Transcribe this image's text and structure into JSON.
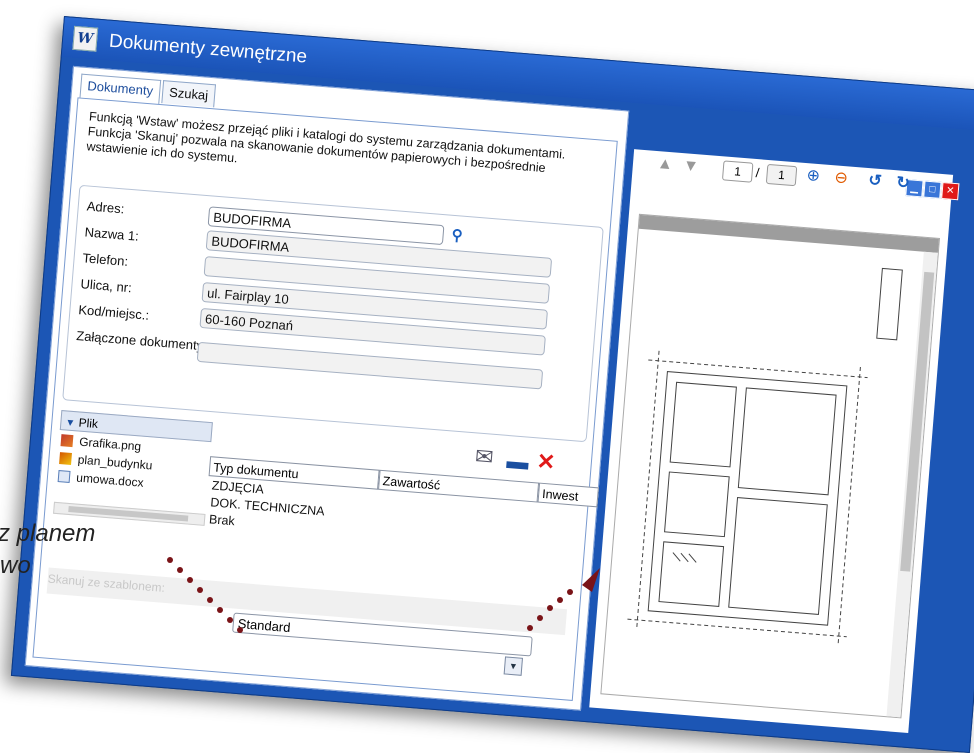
{
  "window": {
    "title": "Dokumenty zewnętrzne",
    "logo": "W"
  },
  "tabs": [
    {
      "label": "Dokumenty"
    },
    {
      "label": "Szukaj"
    }
  ],
  "info_text": "Funkcją 'Wstaw' możesz przejąć pliki i katalogi do systemu zarządzania dokumentami. Funkcja 'Skanuj' pozwala na skanowanie dokumentów papierowych i bezpośrednie wstawienie ich do systemu.",
  "form": {
    "adres_label": "Adres:",
    "adres_value": "BUDOFIRMA",
    "nazwa_label": "Nazwa 1:",
    "nazwa_value": "BUDOFIRMA",
    "telefon_label": "Telefon:",
    "telefon_value": "",
    "ulica_label": "Ulica, nr:",
    "ulica_value": "ul. Fairplay 10",
    "kod_label": "Kod/miejsc.:",
    "kod_value": "60-160 Poznań",
    "zalaczone_label": "Załączone dokumenty:"
  },
  "files": {
    "header": "Plik",
    "items": [
      {
        "name": "Grafika.png",
        "icon": "image-icon"
      },
      {
        "name": "plan_budynku",
        "icon": "image-icon"
      },
      {
        "name": "umowa.docx",
        "icon": "doc-icon"
      }
    ]
  },
  "grid": {
    "columns": [
      "Typ dokumentu",
      "Zawartość",
      "Inwest"
    ],
    "types": [
      "ZDJĘCIA",
      "DOK. TECHNICZNA",
      "Brak"
    ]
  },
  "bottom": {
    "faded_label": "Skanuj ze szablonem:",
    "select_value": "Standard"
  },
  "viewer": {
    "page_current": "1",
    "page_sep": "/",
    "page_total": "1"
  },
  "overlay": {
    "line1": "z planem",
    "line2": "wo"
  },
  "colors": {
    "window_blue": "#1c56b5",
    "accent": "#1a5fc0",
    "delete_red": "#e01919",
    "dots": "#7a1418"
  }
}
